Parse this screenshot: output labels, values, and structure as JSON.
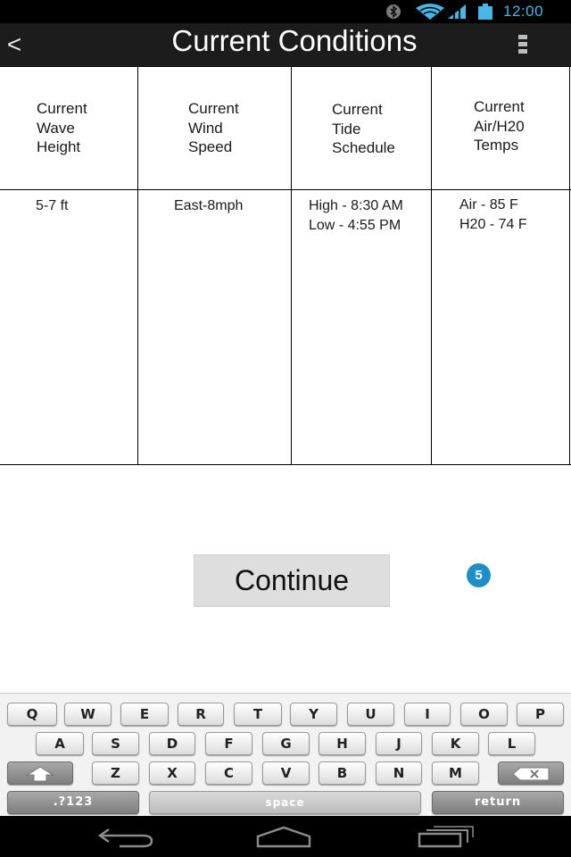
{
  "status_bar": {
    "time": "12:00",
    "icons": [
      "bluetooth-icon",
      "wifi-icon",
      "signal-icon",
      "battery-icon"
    ],
    "accent_color": "#46b7e6"
  },
  "action_bar": {
    "back_glyph": "<",
    "title": "Current Conditions",
    "menu_icon": "overflow-menu-icon"
  },
  "table": {
    "headers": [
      {
        "lines": [
          "Current",
          "Wave",
          "Height"
        ]
      },
      {
        "lines": [
          "Current",
          "Wind",
          "Speed"
        ]
      },
      {
        "lines": [
          "Current",
          "Tide",
          "Schedule"
        ]
      },
      {
        "lines": [
          "Current",
          "Air/H20",
          "Temps"
        ]
      }
    ],
    "values": [
      {
        "lines": [
          "5-7 ft"
        ]
      },
      {
        "lines": [
          "East-8mph"
        ]
      },
      {
        "lines": [
          "High - 8:30 AM",
          "Low - 4:55 PM"
        ]
      },
      {
        "lines": [
          "Air - 85 F",
          "H20 - 74 F"
        ]
      }
    ]
  },
  "continue_label": "Continue",
  "step_badge": "5",
  "keyboard": {
    "row1": [
      "Q",
      "W",
      "E",
      "R",
      "T",
      "Y",
      "U",
      "I",
      "O",
      "P"
    ],
    "row2": [
      "A",
      "S",
      "D",
      "F",
      "G",
      "H",
      "J",
      "K",
      "L"
    ],
    "row3": [
      "Z",
      "X",
      "C",
      "V",
      "B",
      "N",
      "M"
    ],
    "shift_icon": "shift-icon",
    "backspace_icon": "backspace-icon",
    "symbols_label": ".?123",
    "space_label": "space",
    "return_label": "return"
  },
  "nav_bar": {
    "icons": [
      "back-icon",
      "home-icon",
      "recent-apps-icon"
    ]
  }
}
